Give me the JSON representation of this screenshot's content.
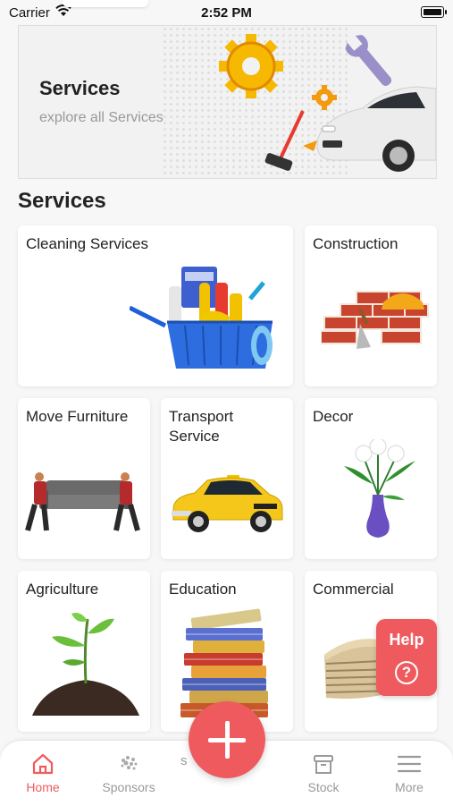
{
  "status_bar": {
    "carrier": "Carrier",
    "time": "2:52 PM"
  },
  "banner": {
    "title": "Services",
    "subtitle": "explore all Services"
  },
  "section_title": "Services",
  "services": [
    {
      "label": "Cleaning Services",
      "icon": "cleaning-basket-icon"
    },
    {
      "label": "Construction",
      "icon": "bricks-helmet-icon"
    },
    {
      "label": "Move Furniture",
      "icon": "movers-sofa-icon"
    },
    {
      "label": "Transport Service",
      "icon": "taxi-icon"
    },
    {
      "label": "Decor",
      "icon": "flower-vase-icon"
    },
    {
      "label": "Agriculture",
      "icon": "plant-seedling-icon"
    },
    {
      "label": "Education",
      "icon": "books-stack-icon"
    },
    {
      "label": "Commercial",
      "icon": "files-stack-icon"
    }
  ],
  "help": {
    "label": "Help",
    "icon_glyph": "?"
  },
  "tabs": {
    "home": "Home",
    "sponsors": "Sponsors",
    "partial": "s",
    "stock": "Stock",
    "more": "More"
  },
  "colors": {
    "accent": "#ef5a5f",
    "inactive": "#999999"
  }
}
